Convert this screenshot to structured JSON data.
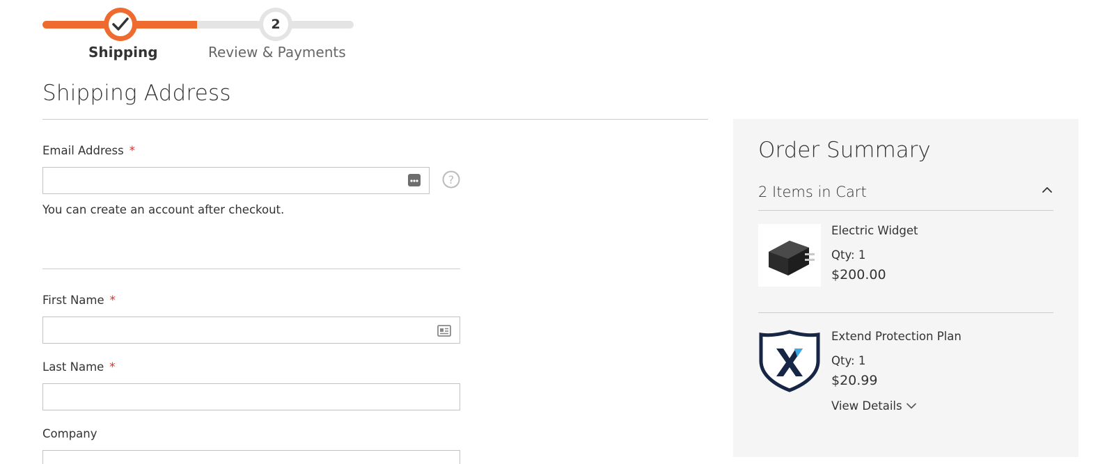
{
  "progress": {
    "steps": [
      {
        "label": "Shipping",
        "state": "complete",
        "icon": "check-icon"
      },
      {
        "label": "Review & Payments",
        "number": "2",
        "state": "pending"
      }
    ],
    "colors": {
      "active": "#ef6a2e",
      "inactive": "#e4e4e4"
    }
  },
  "shipping": {
    "title": "Shipping Address",
    "email": {
      "label": "Email Address",
      "required_mark": "*",
      "value": "",
      "icon": "password-dots-icon",
      "help_icon": "help-question-icon"
    },
    "email_note": "You can create an account after checkout.",
    "first_name": {
      "label": "First Name",
      "required_mark": "*",
      "value": "",
      "icon": "contact-card-icon"
    },
    "last_name": {
      "label": "Last Name",
      "required_mark": "*",
      "value": ""
    },
    "company": {
      "label": "Company",
      "value": ""
    }
  },
  "summary": {
    "title": "Order Summary",
    "cart_count": "2 Items in Cart",
    "toggle_icon": "chevron-up-icon",
    "items": [
      {
        "name": "Electric Widget",
        "qty": "Qty: 1",
        "price": "$200.00",
        "image": "power-adapter-image"
      },
      {
        "name": "Extend Protection Plan",
        "qty": "Qty: 1",
        "price": "$20.99",
        "image": "extend-shield-logo",
        "details_label": "View Details"
      }
    ]
  },
  "colors": {
    "required": "#e02b27",
    "summary_bg": "#f5f5f5",
    "border": "#c2c2c2"
  }
}
